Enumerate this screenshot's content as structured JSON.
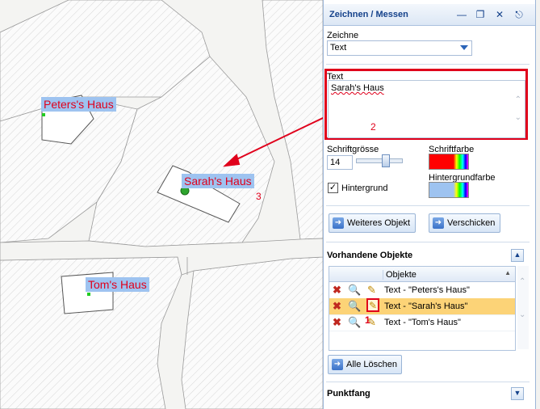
{
  "map": {
    "labels": [
      "Peters's Haus",
      "Sarah's Haus",
      "Tom's Haus"
    ],
    "annotations": [
      "1",
      "2",
      "3"
    ]
  },
  "panel": {
    "title": "Zeichnen / Messen",
    "zeichne_label": "Zeichne",
    "zeichne_value": "Text",
    "text_label": "Text",
    "text_value": "Sarah's Haus",
    "schriftgroesse_label": "Schriftgrösse",
    "schriftgroesse_value": "14",
    "schriftfarbe_label": "Schriftfarbe",
    "hintergrund_label": "Hintergrund",
    "hintergrundfarbe_label": "Hintergrundfarbe",
    "hintergrund_checked": true,
    "weiteres_objekt_label": "Weiteres Objekt",
    "verschicken_label": "Verschicken",
    "vorhandene_label": "Vorhandene Objekte",
    "grid_header": "Objekte",
    "rows": [
      "Text - \"Peters's Haus\"",
      "Text - \"Sarah's Haus\"",
      "Text - \"Tom's Haus\""
    ],
    "selected_row": 1,
    "alle_loeschen_label": "Alle Löschen",
    "punktfang_label": "Punktfang"
  },
  "colors": {
    "label_text": "#e0001b",
    "label_bg": "#9ec3f0",
    "schriftfarbe": "#ff0000",
    "selected_row": "#fcd377",
    "annotation": "#e0001b"
  },
  "icons": [
    "minimize-icon",
    "restore-icon",
    "close-icon",
    "pin-icon",
    "chevron-down-icon",
    "delete-icon",
    "zoom-icon",
    "edit-pencil-icon",
    "collapse-icon",
    "expand-icon"
  ]
}
